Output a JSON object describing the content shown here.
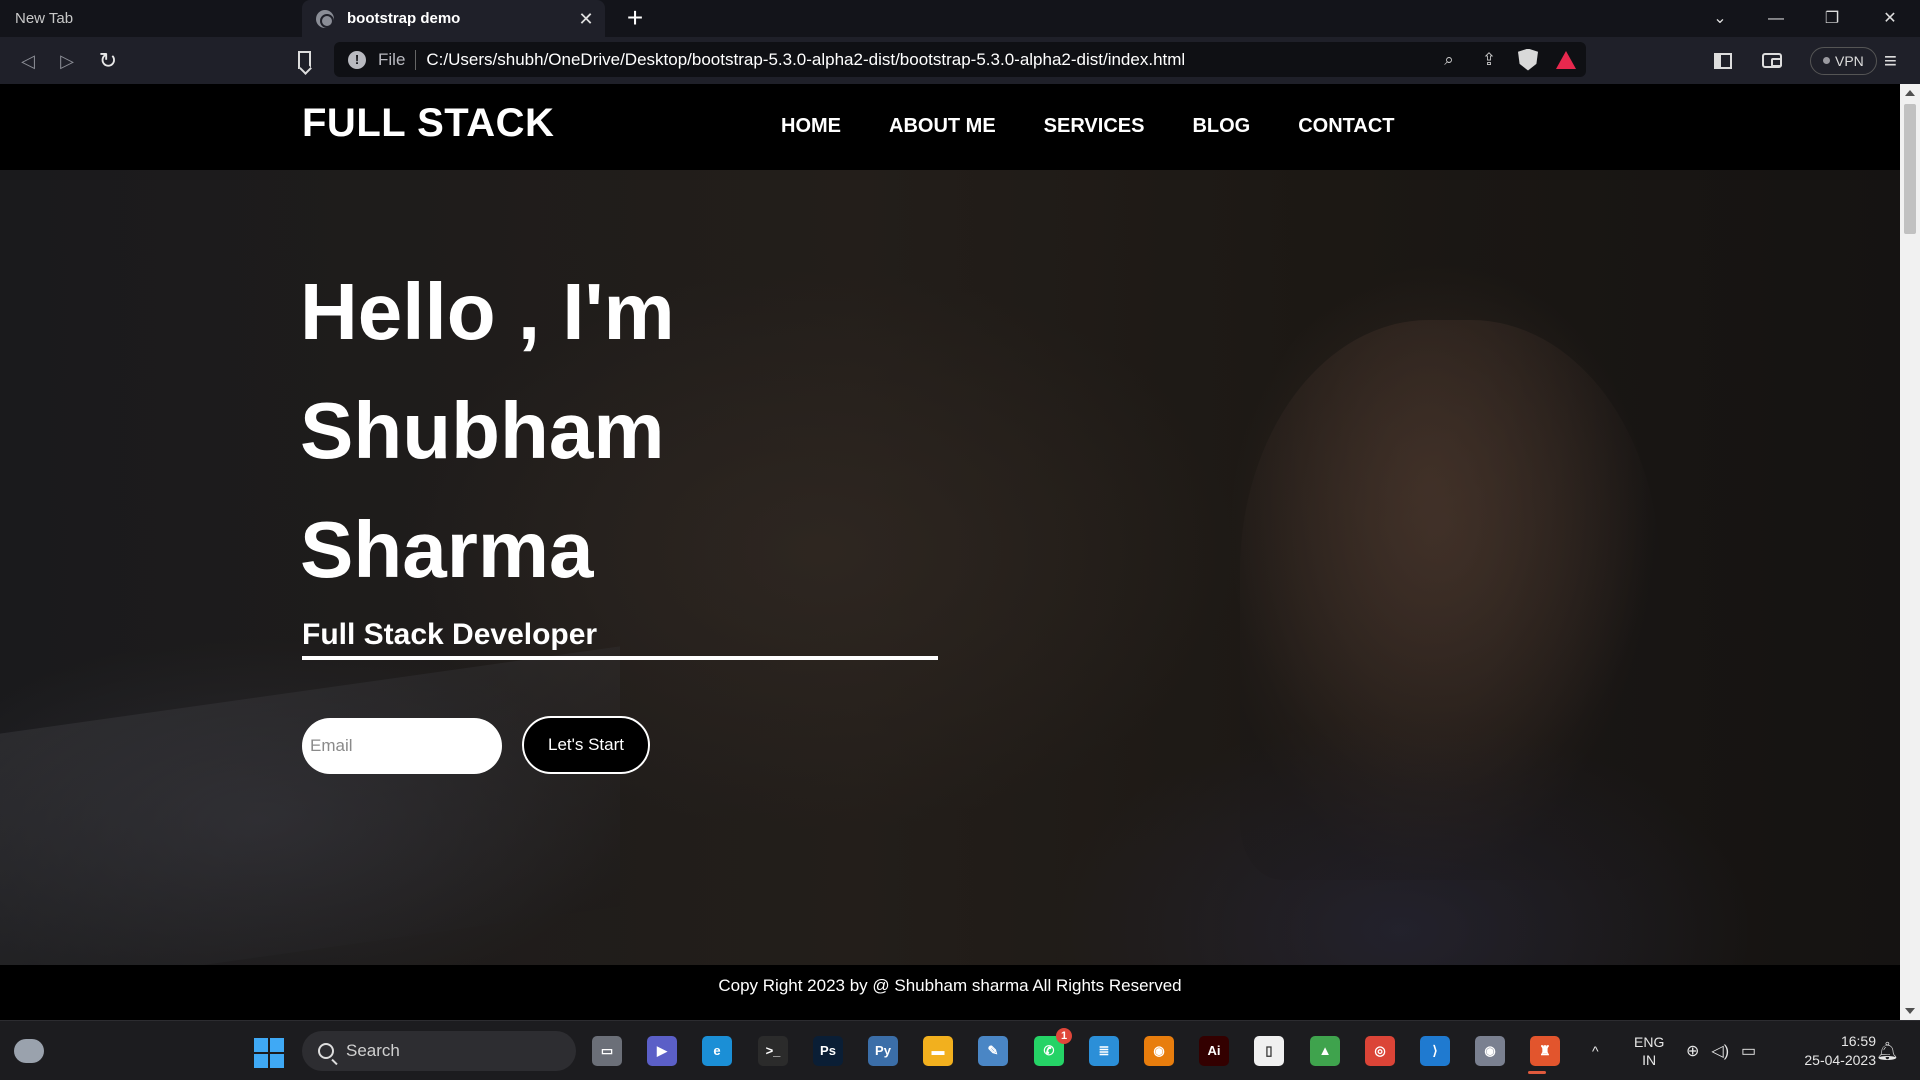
{
  "browser": {
    "tabs": [
      {
        "title": "New Tab",
        "active": false
      },
      {
        "title": "bootstrap demo",
        "active": true
      }
    ],
    "tab_close_glyph": "✕",
    "new_tab_glyph": "+",
    "window_controls": {
      "list": "⌄",
      "minimize": "—",
      "restore": "❐",
      "close": "✕"
    },
    "nav": {
      "back": "◁",
      "forward": "▷",
      "reload": "↻"
    },
    "address": {
      "scheme_label": "File",
      "url": "C:/Users/shubh/OneDrive/Desktop/bootstrap-5.3.0-alpha2-dist/bootstrap-5.3.0-alpha2-dist/index.html"
    },
    "omnibox_icons": [
      "zoom-icon",
      "share-icon",
      "brave-shields-icon",
      "brave-rewards-icon"
    ],
    "vpn_label": "VPN",
    "menu_glyph": "≡"
  },
  "site": {
    "logo": "FULL STACK",
    "nav": [
      {
        "label": "HOME"
      },
      {
        "label": "ABOUT ME"
      },
      {
        "label": "SERVICES"
      },
      {
        "label": "BLOG"
      },
      {
        "label": "CONTACT"
      }
    ],
    "hero": {
      "line1": "Hello , I'm",
      "line2": "Shubham",
      "line3": "Sharma",
      "subtitle": "Full Stack Developer",
      "email_placeholder": "Email",
      "button_label": "Let's Start"
    },
    "footer": "Copy Right 2023 by @ Shubham sharma All Rights Reserved"
  },
  "taskbar": {
    "search_label": "Search",
    "apps": [
      {
        "name": "task-view",
        "glyph": "▭",
        "color": "#6b6f78"
      },
      {
        "name": "teams",
        "glyph": "▶",
        "color": "#5b5fc7"
      },
      {
        "name": "edge",
        "glyph": "e",
        "color": "#1b8fd6"
      },
      {
        "name": "terminal",
        "glyph": ">_",
        "color": "#2b2b2b"
      },
      {
        "name": "photoshop",
        "glyph": "Ps",
        "color": "#0a1e35"
      },
      {
        "name": "python",
        "glyph": "Py",
        "color": "#3b6ea8"
      },
      {
        "name": "file-explorer",
        "glyph": "▬",
        "color": "#f2b01e"
      },
      {
        "name": "notepad-app",
        "glyph": "✎",
        "color": "#4a86c5"
      },
      {
        "name": "whatsapp",
        "glyph": "✆",
        "color": "#25d366",
        "badge": "1"
      },
      {
        "name": "notepad",
        "glyph": "≣",
        "color": "#2b8fd8"
      },
      {
        "name": "blender",
        "glyph": "◉",
        "color": "#e87d0d"
      },
      {
        "name": "illustrator",
        "glyph": "Ai",
        "color": "#330000"
      },
      {
        "name": "blank-document",
        "glyph": "▯",
        "color": "#f0f0f0"
      },
      {
        "name": "image-viewer",
        "glyph": "▲",
        "color": "#3fa34d"
      },
      {
        "name": "chrome",
        "glyph": "◎",
        "color": "#db4437"
      },
      {
        "name": "vscode",
        "glyph": "⟩",
        "color": "#1f7ad0"
      },
      {
        "name": "camera",
        "glyph": "◉",
        "color": "#7a8090"
      },
      {
        "name": "brave",
        "glyph": "♜",
        "color": "#e2552d"
      }
    ],
    "tray": {
      "chevron": "^",
      "lang_line1": "ENG",
      "lang_line2": "IN",
      "time": "16:59",
      "date": "25-04-2023"
    }
  }
}
